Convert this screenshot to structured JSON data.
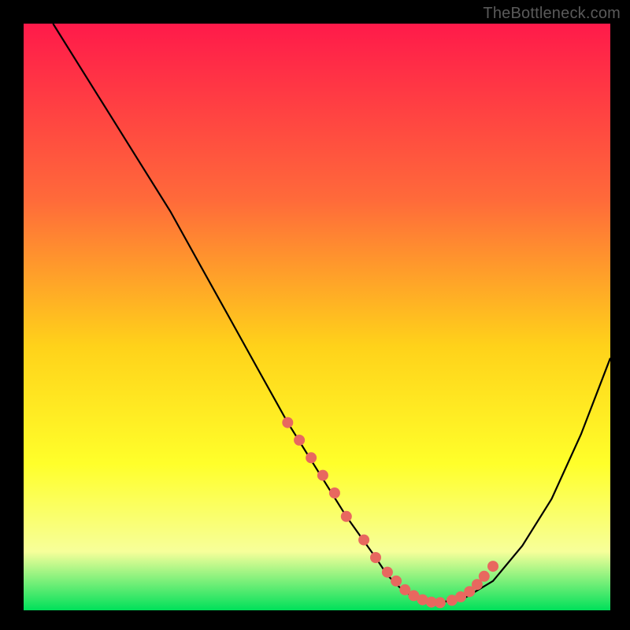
{
  "watermark": "TheBottleneck.com",
  "colors": {
    "bg": "#000000",
    "curve": "#000000",
    "dot": "#e8685f",
    "gradient_top": "#ff1a4a",
    "gradient_mid1": "#ff6a3a",
    "gradient_mid2": "#ffd21a",
    "gradient_mid3": "#ffff2a",
    "gradient_mid4": "#f7ff9a",
    "gradient_bottom": "#00e05a"
  },
  "chart_data": {
    "type": "line",
    "title": "",
    "xlabel": "",
    "ylabel": "",
    "xlim": [
      0,
      100
    ],
    "ylim": [
      0,
      100
    ],
    "grid": false,
    "series": [
      {
        "name": "bottleneck-curve",
        "x": [
          5,
          10,
          15,
          20,
          25,
          30,
          35,
          40,
          45,
          50,
          55,
          60,
          62,
          64,
          66,
          68,
          70,
          75,
          80,
          85,
          90,
          95,
          100
        ],
        "values": [
          100,
          92,
          84,
          76,
          68,
          59,
          50,
          41,
          32,
          24,
          16,
          9,
          6,
          4,
          2.5,
          1.7,
          1.2,
          2,
          5,
          11,
          19,
          30,
          43
        ]
      }
    ],
    "dots_x": [
      45,
      47,
      49,
      51,
      53,
      55,
      58,
      60,
      62,
      63.5,
      65,
      66.5,
      68,
      69.5,
      71,
      73,
      74.5,
      76,
      77.3,
      78.5,
      80
    ],
    "dots_y": [
      32,
      29,
      26,
      23,
      20,
      16,
      12,
      9,
      6.5,
      5,
      3.5,
      2.5,
      1.8,
      1.4,
      1.3,
      1.7,
      2.3,
      3.2,
      4.4,
      5.8,
      7.5
    ]
  }
}
